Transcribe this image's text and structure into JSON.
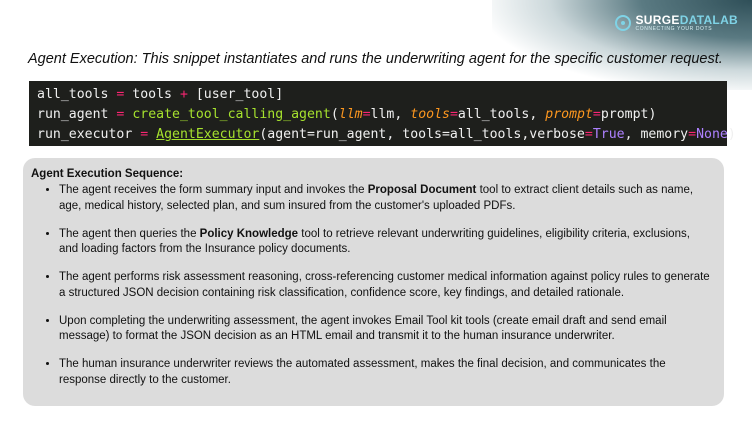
{
  "brand": {
    "name_part1": "SURGE",
    "name_part2": "DATALAB",
    "tagline": "CONNECTING YOUR DOTS"
  },
  "title": "Agent Execution: This snippet instantiates and runs the underwriting agent for the specific customer request.",
  "code": {
    "line1": {
      "a": "all_tools ",
      "op1": "=",
      "b": " tools ",
      "op2": "+",
      "c": " [user_tool]"
    },
    "line2": {
      "a": "run_agent ",
      "op1": "=",
      "b": " ",
      "fn": "create_tool_calling_agent",
      "c": "(",
      "p1": "llm",
      "op2": "=",
      "d": "llm, ",
      "p2": "tools",
      "op3": "=",
      "e": "all_tools, ",
      "p3": "prompt",
      "op4": "=",
      "f": "prompt)"
    },
    "line3": {
      "a": "run_executor ",
      "op1": "=",
      "b": " ",
      "cls": "AgentExecutor",
      "c": "(agent=run_agent, tools=all_tools,verbose",
      "op2": "=",
      "t": "True",
      "d": ", memory",
      "op3": "=",
      "n": "None",
      "e": ")"
    }
  },
  "sequence": {
    "heading": "Agent Execution Sequence:",
    "items": [
      {
        "pre": "The agent receives the form summary input and invokes the ",
        "bold": "Proposal Document",
        "post": " tool to extract client details such as name, age, medical history, selected plan, and sum insured from the customer's uploaded PDFs."
      },
      {
        "pre": "The agent then queries the ",
        "bold": "Policy Knowledge",
        "post": " tool to retrieve relevant underwriting guidelines, eligibility criteria, exclusions, and loading factors from the Insurance policy documents."
      },
      {
        "pre": "The agent performs risk assessment reasoning, cross-referencing customer medical information against policy rules to generate a structured JSON decision containing risk classification, confidence score, key findings, and detailed rationale.",
        "bold": "",
        "post": ""
      },
      {
        "pre": "Upon completing the underwriting assessment, the agent invokes Email Tool kit tools (create email draft and send email message) to format the JSON decision as an HTML email and transmit it to the human insurance underwriter.",
        "bold": "",
        "post": ""
      },
      {
        "pre": "The human insurance underwriter reviews the automated assessment, makes the final decision, and communicates the response directly to the customer.",
        "bold": "",
        "post": ""
      }
    ]
  }
}
